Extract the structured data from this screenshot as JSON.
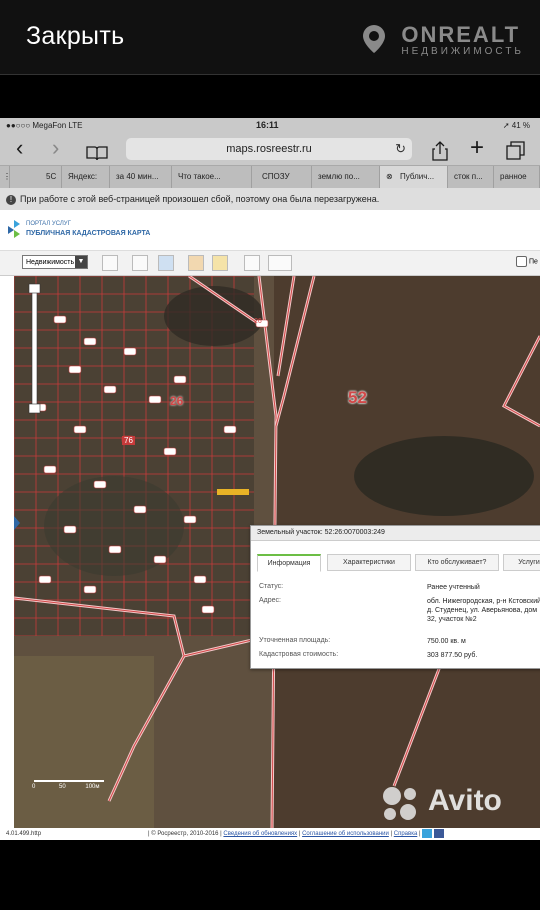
{
  "app": {
    "close_label": "Закрыть",
    "brand_name": "ONREALT",
    "brand_sub": "НЕДВИЖИМОСТЬ",
    "watermark": "Avito"
  },
  "status_bar": {
    "carrier": "●●○○○ MegaFon  LTE",
    "time": "16:11",
    "battery": "➚ 41 %"
  },
  "browser": {
    "url": "maps.rosreestr.ru",
    "tabs": [
      "5С",
      "Яндекс:",
      "за 40 мин...",
      "Что такое...",
      "СПОЗУ",
      "землю по...",
      "Публич...",
      "сток п...",
      "ранное"
    ],
    "warning": "При работе с этой веб-страницей произошел сбой, поэтому она была перезагружена."
  },
  "site": {
    "logo_line1": "ПОРТАЛ УСЛУГ",
    "logo_line2": "ПУБЛИЧНАЯ КАДАСТРОВАЯ КАРТА",
    "layer_select": "Недвижимость",
    "panel_check": "Пе",
    "footer_version": "4.01.499.http",
    "footer_text": "| © Росреестр, 2010-2016 |",
    "footer_link1": "Сведения об обновлениях",
    "footer_link2": "Соглашение об использовании",
    "footer_link3": "Справка"
  },
  "map": {
    "numbers": [
      "52",
      "26",
      "26",
      "76"
    ],
    "scale_labels": [
      "0",
      "50",
      "100м"
    ]
  },
  "popup": {
    "title": "Земельный участок: 52:26:0070003:249",
    "tabs": [
      "Информация",
      "Характеристики",
      "Кто обслуживает?",
      "Услуги"
    ],
    "rows": [
      {
        "label": "Статус:",
        "value": "Ранее учтенный"
      },
      {
        "label": "Адрес:",
        "value": "обл. Нижегородская, р-н Кстовский, д. Студенец, ул. Аверьянова, дом 32, участок №2"
      },
      {
        "label": "Уточненная площадь:",
        "value": "750.00 кв. м"
      },
      {
        "label": "Кадастровая стоимость:",
        "value": "303 877.50 руб."
      }
    ]
  }
}
